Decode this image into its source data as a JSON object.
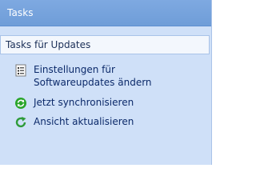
{
  "panel": {
    "title": "Tasks",
    "group_title": "Tasks für Updates",
    "tasks": [
      {
        "label": "Einstellungen für Softwareupdates ändern",
        "icon": "settings-list-icon"
      },
      {
        "label": "Jetzt synchronisieren",
        "icon": "sync-icon"
      },
      {
        "label": "Ansicht aktualisieren",
        "icon": "refresh-icon"
      }
    ]
  },
  "colors": {
    "header": "#7ea9e1",
    "pane": "#cfe0f8",
    "link": "#0c2a6a",
    "sync_icon": "#2aa52a"
  }
}
